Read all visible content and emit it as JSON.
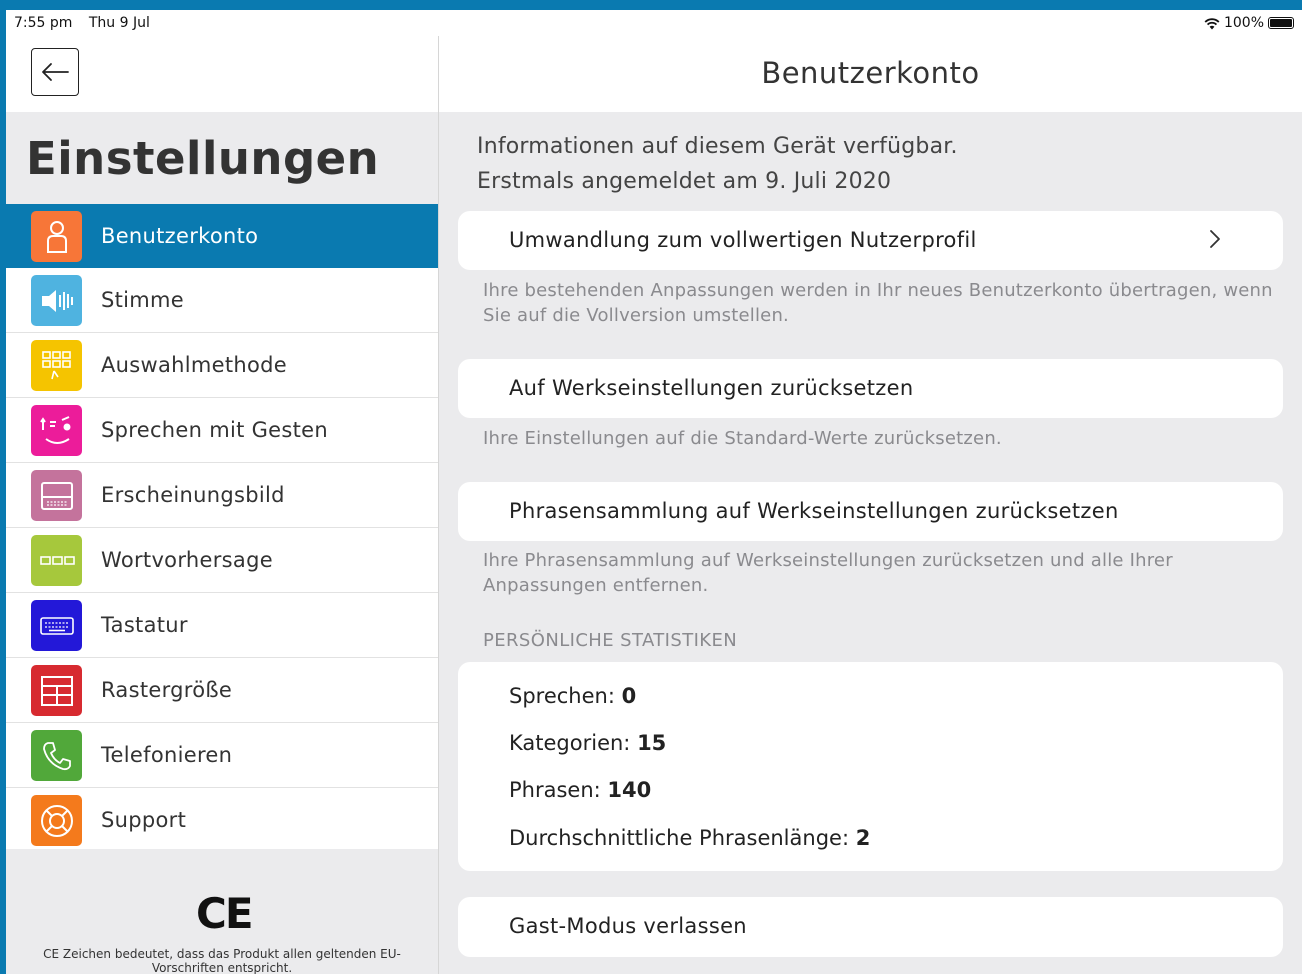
{
  "status_bar": {
    "time": "7:55 pm",
    "date": "Thu 9 Jul",
    "battery": "100%"
  },
  "sidebar": {
    "title": "Einstellungen",
    "items": [
      {
        "label": "Benutzerkonto",
        "icon": "user-icon",
        "color": "#f77638",
        "active": true
      },
      {
        "label": "Stimme",
        "icon": "speaker-icon",
        "color": "#4fb3e0"
      },
      {
        "label": "Auswahlmethode",
        "icon": "selection-grid-icon",
        "color": "#f5c400"
      },
      {
        "label": "Sprechen mit Gesten",
        "icon": "gesture-face-icon",
        "color": "#ec1c9a"
      },
      {
        "label": "Erscheinungsbild",
        "icon": "appearance-icon",
        "color": "#c4739c"
      },
      {
        "label": "Wortvorhersage",
        "icon": "word-prediction-icon",
        "color": "#a6c83c"
      },
      {
        "label": "Tastatur",
        "icon": "keyboard-icon",
        "color": "#2318d8"
      },
      {
        "label": "Rastergröße",
        "icon": "grid-size-icon",
        "color": "#d72a30"
      },
      {
        "label": "Telefonieren",
        "icon": "phone-icon",
        "color": "#51a83a"
      },
      {
        "label": "Support",
        "icon": "lifebuoy-icon",
        "color": "#f47a1c"
      }
    ],
    "footer": {
      "ce_mark": "CE",
      "ce_text": "CE Zeichen bedeutet, dass das Produkt allen geltenden EU-Vorschriften entspricht."
    }
  },
  "main": {
    "title": "Benutzerkonto",
    "info_line_1": "Informationen auf diesem Gerät verfügbar.",
    "info_line_2": "Erstmals angemeldet am 9. Juli 2020",
    "convert": {
      "label": "Umwandlung zum vollwertigen Nutzerprofil",
      "note": "Ihre bestehenden Anpassungen werden in Ihr neues Benutzerkonto übertragen, wenn Sie auf die Vollversion umstellen."
    },
    "factory_reset": {
      "label": "Auf Werkseinstellungen zurücksetzen",
      "note": "Ihre Einstellungen auf die Standard-Werte zurücksetzen."
    },
    "phrase_reset": {
      "label": "Phrasensammlung auf Werkseinstellungen zurücksetzen",
      "note": "Ihre Phrasensammlung auf Werkseinstellungen zurücksetzen und alle Ihrer Anpassungen entfernen."
    },
    "stats": {
      "header": "PERSÖNLICHE STATISTIKEN",
      "items": [
        {
          "label": "Sprechen: ",
          "value": "0"
        },
        {
          "label": "Kategorien: ",
          "value": "15"
        },
        {
          "label": "Phrasen: ",
          "value": "140"
        },
        {
          "label": "Durchschnittliche Phrasenlänge: ",
          "value": "2"
        }
      ]
    },
    "guest_exit": {
      "label": "Gast-Modus verlassen"
    }
  },
  "colors": {
    "accent": "#0a7ab0",
    "background": "#ebebed"
  }
}
